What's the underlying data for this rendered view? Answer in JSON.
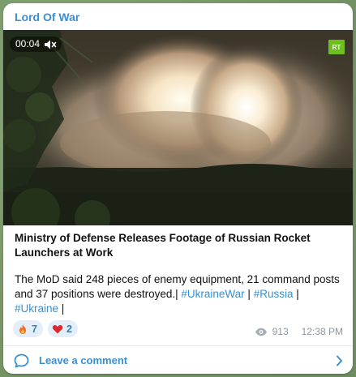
{
  "post": {
    "channel_name": "Lord Of War",
    "video": {
      "duration": "00:04",
      "muted": true,
      "watermark": "RT",
      "icons": {
        "mute": "speaker-muted-icon",
        "watermark": "rt-logo"
      }
    },
    "title": "Ministry of Defense Releases Footage of Russian Rocket Launchers at Work",
    "body_text": "The MoD said 248 pieces of enemy equipment, 21 command posts and 37 positions were destroyed.| ",
    "hashtags": [
      {
        "text": "#UkraineWar",
        "sep": " | "
      },
      {
        "text": "#Russia",
        "sep": " | "
      },
      {
        "text": "#Ukraine",
        "sep": " |"
      }
    ],
    "reactions": [
      {
        "emoji": "fire-emoji",
        "count": "7"
      },
      {
        "emoji": "red-heart-emoji",
        "count": "2"
      }
    ],
    "views": "913",
    "time": "12:38 PM",
    "comment_label": "Leave a comment"
  },
  "colors": {
    "accent": "#3a8fd1",
    "reaction_bg": "#e3eef8",
    "meta": "#8d979e",
    "rt_green": "#6bbf1f"
  }
}
